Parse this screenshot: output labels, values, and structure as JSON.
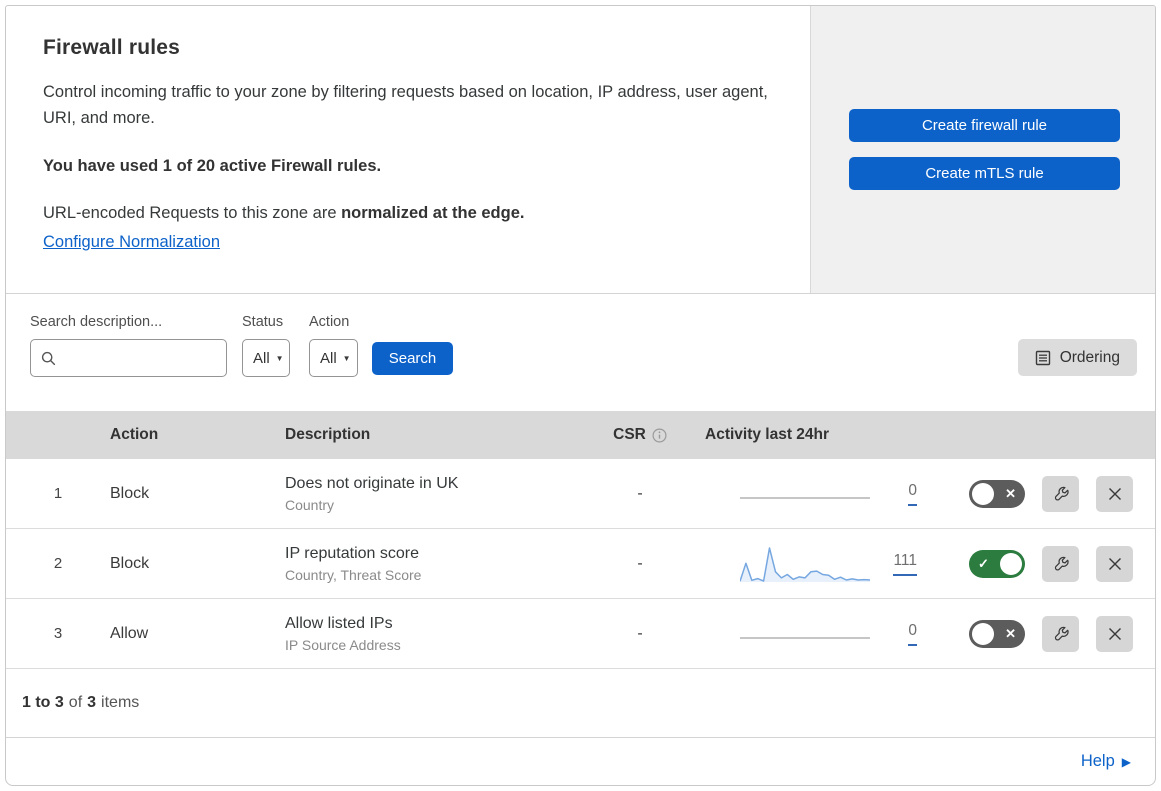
{
  "header": {
    "title": "Firewall rules",
    "description": "Control incoming traffic to your zone by filtering requests based on location, IP address, user agent, URI, and more.",
    "usage": "You have used 1 of 20 active Firewall rules.",
    "normalization_prefix": "URL-encoded Requests to this zone are ",
    "normalization_bold": "normalized at the edge.",
    "normalization_link": "Configure Normalization",
    "create_firewall_label": "Create firewall rule",
    "create_mtls_label": "Create mTLS rule"
  },
  "filters": {
    "search_label": "Search description...",
    "search_value": "",
    "search_placeholder": "",
    "status_label": "Status",
    "status_value": "All",
    "action_label": "Action",
    "action_value": "All",
    "search_button": "Search",
    "ordering_button": "Ordering"
  },
  "table": {
    "columns": {
      "action": "Action",
      "description": "Description",
      "csr": "CSR",
      "activity": "Activity last 24hr"
    },
    "rows": [
      {
        "index": "1",
        "action": "Block",
        "description": "Does not originate in UK",
        "fields": "Country",
        "csr": "-",
        "activity_count": "0",
        "enabled": false,
        "sparkline": null
      },
      {
        "index": "2",
        "action": "Block",
        "description": "IP reputation score",
        "fields": "Country, Threat Score",
        "csr": "-",
        "activity_count": "111",
        "enabled": true,
        "sparkline": [
          2,
          55,
          5,
          10,
          3,
          100,
          30,
          12,
          22,
          8,
          15,
          12,
          30,
          32,
          22,
          20,
          8,
          14,
          6,
          9,
          6,
          7,
          6
        ]
      },
      {
        "index": "3",
        "action": "Allow",
        "description": "Allow listed IPs",
        "fields": "IP Source Address",
        "csr": "-",
        "activity_count": "0",
        "enabled": false,
        "sparkline": null
      }
    ]
  },
  "footer": {
    "range": "1 to 3",
    "of": "of",
    "total": "3",
    "items": "items",
    "help_label": "Help"
  },
  "colors": {
    "accent_blue": "#0d62c9",
    "toggle_on_green": "#2b7c3e",
    "toggle_off_gray": "#5c5c5c",
    "sparkline_blue": "#76a7e0",
    "sparkline_fill": "#e7f0fb",
    "header_band_gray": "#d9d9d9",
    "panel_gray": "#f0f0f1"
  }
}
